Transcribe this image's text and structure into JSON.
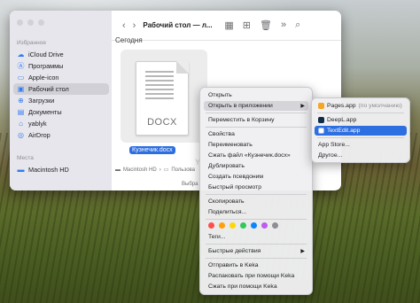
{
  "sidebar": {
    "favorites_label": "Избранное",
    "items": [
      {
        "label": "iCloud Drive",
        "icon": "cloud-icon"
      },
      {
        "label": "Программы",
        "icon": "apps-icon"
      },
      {
        "label": "Apple-icon",
        "icon": "folder-icon"
      },
      {
        "label": "Рабочий стол",
        "icon": "desktop-icon"
      },
      {
        "label": "Загрузки",
        "icon": "download-icon"
      },
      {
        "label": "Документы",
        "icon": "document-icon"
      },
      {
        "label": "yablyk",
        "icon": "home-icon"
      },
      {
        "label": "AirDrop",
        "icon": "airdrop-icon"
      }
    ],
    "locations_label": "Места",
    "locations": [
      {
        "label": "Macintosh HD",
        "icon": "disk-icon"
      }
    ]
  },
  "toolbar": {
    "title": "Рабочий стол — л...",
    "back": "‹",
    "forward": "›"
  },
  "content": {
    "section_title": "Сегодня",
    "file_name": "Кузнечик.docx",
    "file_type_label": "DOCX",
    "pathbar": [
      "Macintosh HD",
      "Пользова"
    ],
    "status": "Выбра",
    "watermark": "Yablyk"
  },
  "context_menu": {
    "items": [
      "Открыть",
      "Открыть в приложении",
      "Переместить в Корзину",
      "Свойства",
      "Переименовать",
      "Сжать файл «Кузнечик.docx»",
      "Дублировать",
      "Создать псевдоним",
      "Быстрый просмотр",
      "Скопировать",
      "Поделиться...",
      "Теги...",
      "Быстрые действия",
      "Отправить в Keka",
      "Распаковать при помощи Keka",
      "Сжать при помощи Keka"
    ],
    "tag_colors": [
      "#ff4d4d",
      "#ff9f0a",
      "#ffd60a",
      "#34c759",
      "#0a84ff",
      "#bf5af2",
      "#8e8e93"
    ]
  },
  "submenu": {
    "items": [
      {
        "label": "Pages.app",
        "note": "(по умолчанию)",
        "icon": "pages-icon",
        "color": "#f5a623"
      },
      {
        "label": "DeepL.app",
        "note": "",
        "icon": "deepl-icon",
        "color": "#0f2b46"
      },
      {
        "label": "TextEdit.app",
        "note": "",
        "icon": "textedit-icon",
        "color": "#ffffff"
      },
      {
        "label": "App Store...",
        "note": "",
        "icon": "",
        "color": ""
      },
      {
        "label": "Другое...",
        "note": "",
        "icon": "",
        "color": ""
      }
    ]
  },
  "colors": {
    "accent": "#2d6ee0",
    "sidebar_icon": "#2f7cf6"
  }
}
